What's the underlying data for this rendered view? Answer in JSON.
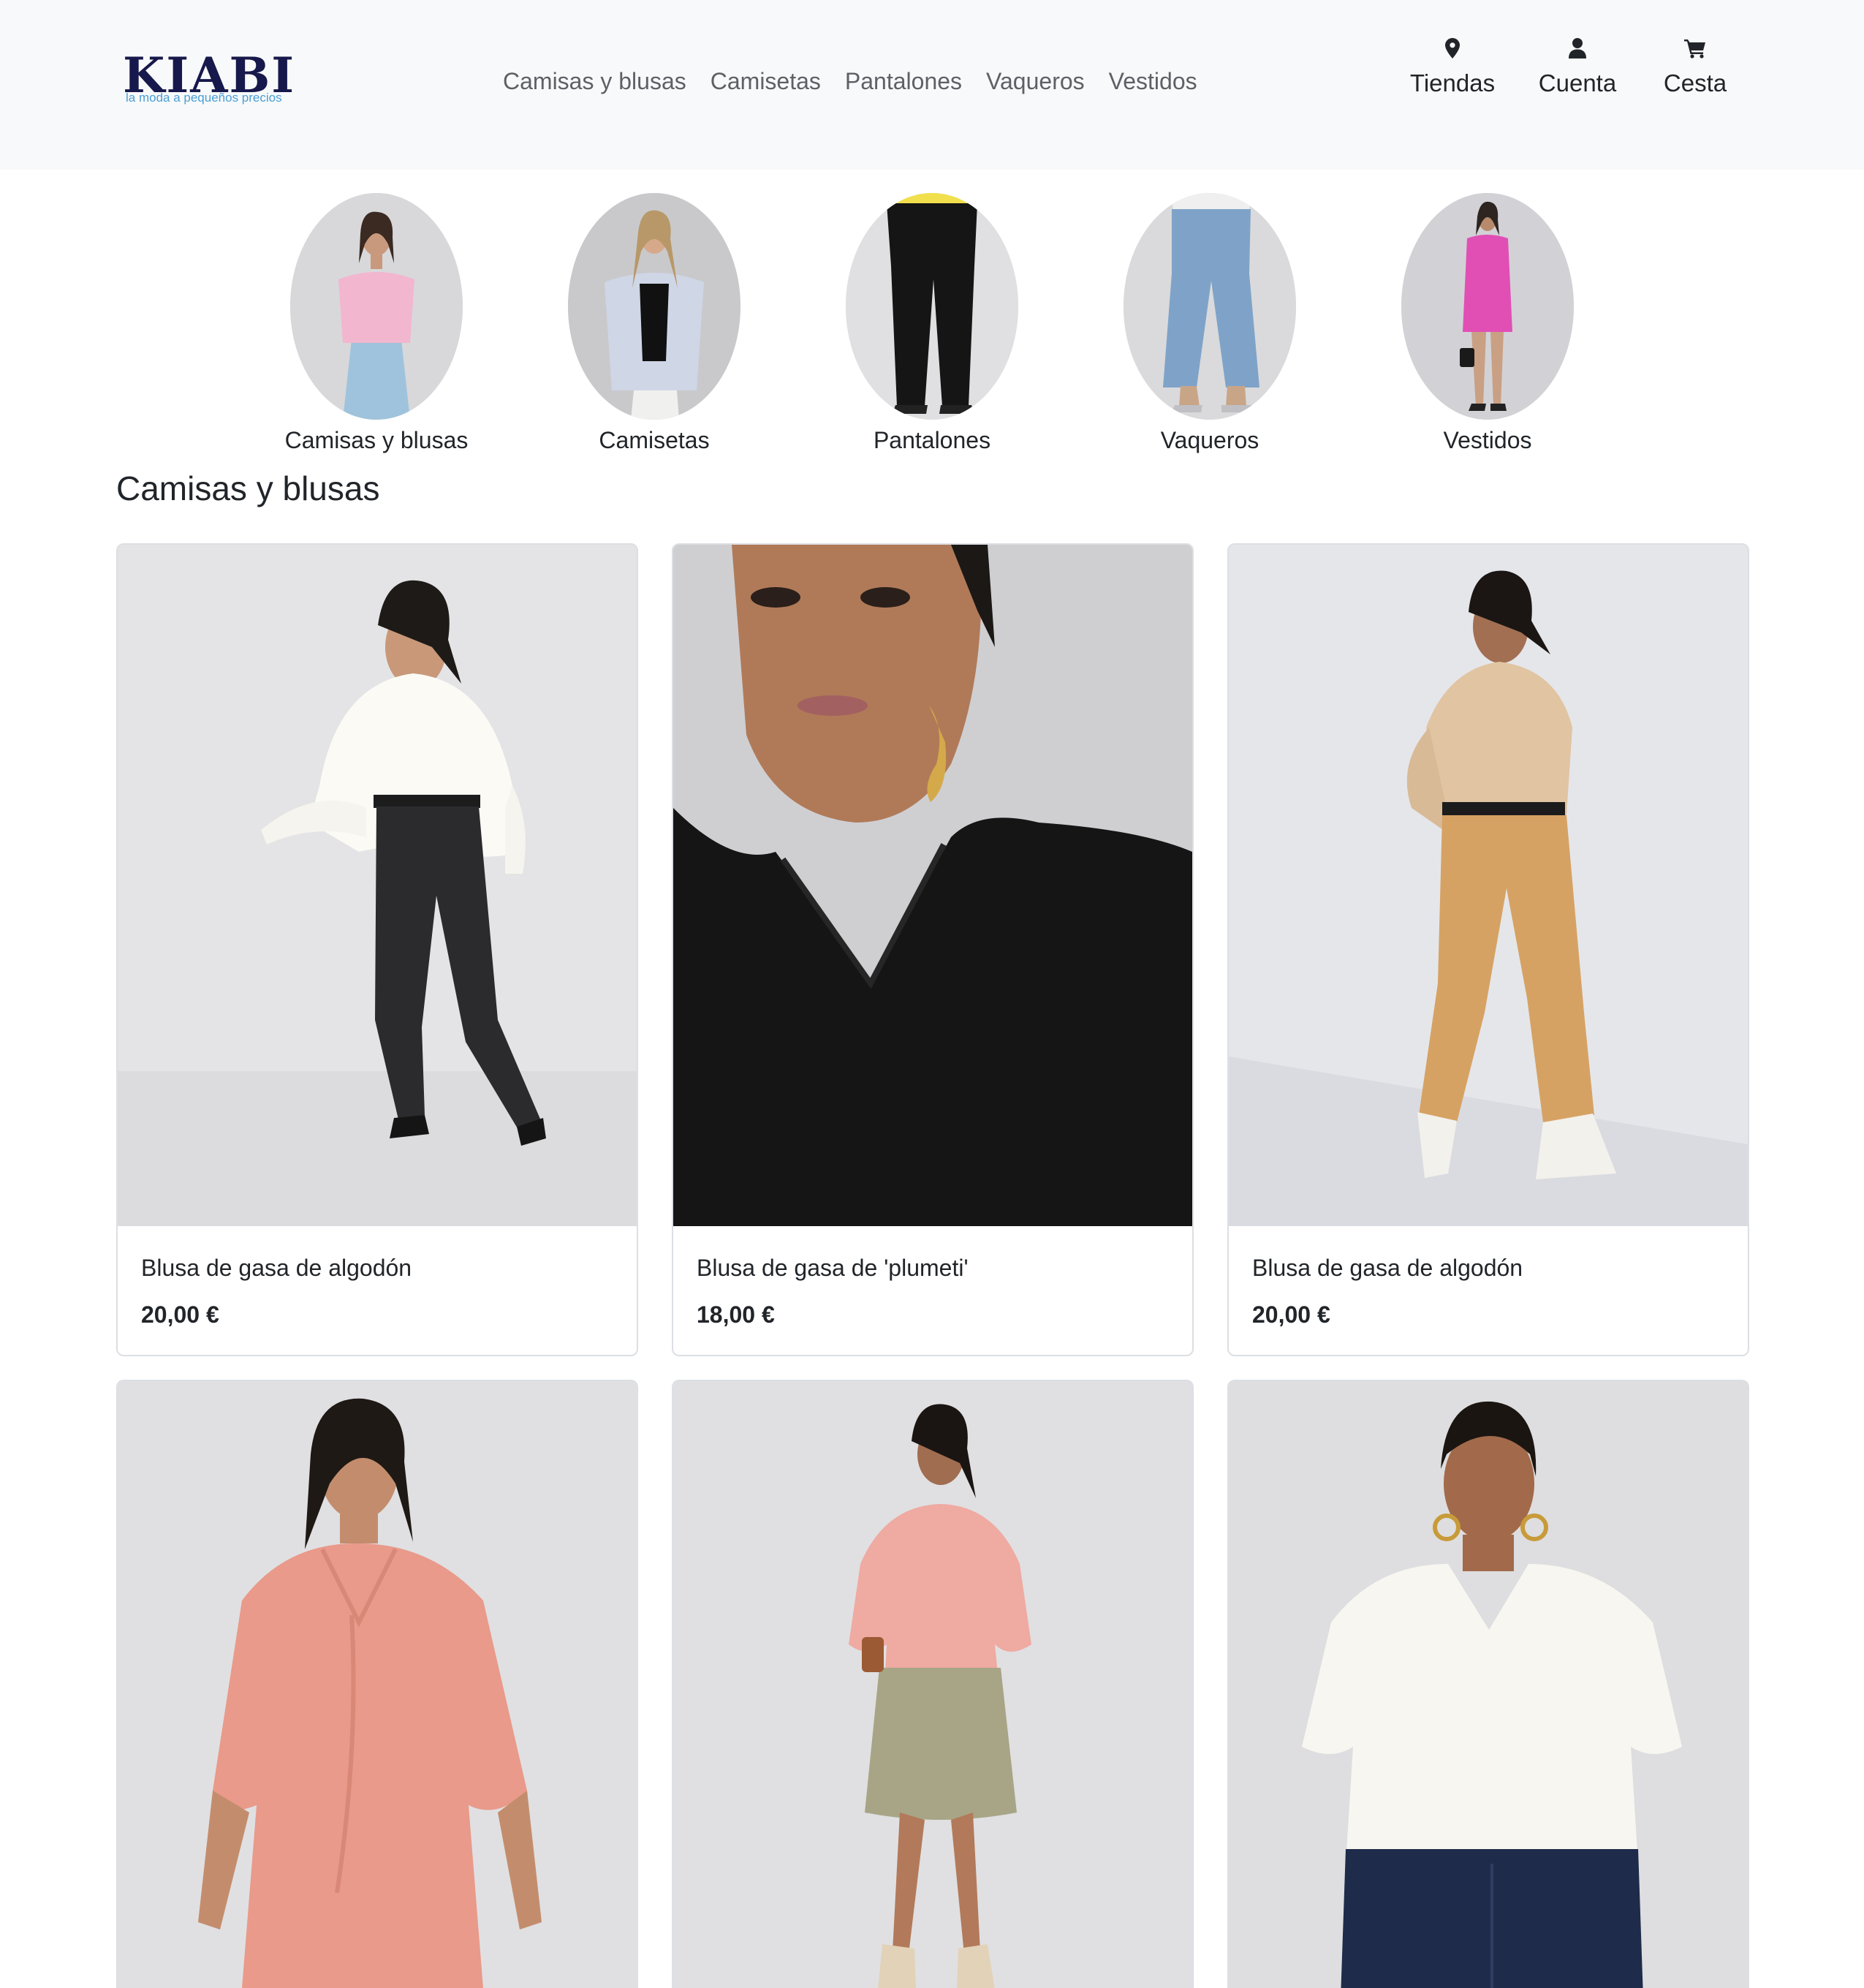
{
  "brand": {
    "name": "KIABI",
    "tagline": "la moda a pequeños precios",
    "color": "#17184b",
    "tagline_color": "#4a9fd4"
  },
  "nav": {
    "items": [
      {
        "label": "Camisas y blusas"
      },
      {
        "label": "Camisetas"
      },
      {
        "label": "Pantalones"
      },
      {
        "label": "Vaqueros"
      },
      {
        "label": "Vestidos"
      }
    ]
  },
  "header_actions": {
    "stores": {
      "label": "Tiendas",
      "icon": "map-marker-icon"
    },
    "account": {
      "label": "Cuenta",
      "icon": "user-icon"
    },
    "cart": {
      "label": "Cesta",
      "icon": "shopping-cart-icon"
    }
  },
  "categories": [
    {
      "label": "Camisas y blusas",
      "image": "woman in pink t-shirt and light jeans"
    },
    {
      "label": "Camisetas",
      "image": "woman in striped open shirt over black top"
    },
    {
      "label": "Pantalones",
      "image": "black wide-leg trousers"
    },
    {
      "label": "Vaqueros",
      "image": "light blue wide-leg jeans"
    },
    {
      "label": "Vestidos",
      "image": "woman in pink dress with black bag"
    }
  ],
  "section": {
    "title": "Camisas y blusas"
  },
  "products": [
    {
      "name": "Blusa de gasa de algodón",
      "price": "20,00 €",
      "image": "woman in white cotton gauze blouse and black jeans"
    },
    {
      "name": "Blusa de gasa de 'plumeti'",
      "price": "18,00 €",
      "image": "close-up of woman in black plumeti blouse"
    },
    {
      "name": "Blusa de gasa de algodón",
      "price": "20,00 €",
      "image": "woman in beige blouse and camel trousers"
    },
    {
      "name": "",
      "price": "",
      "image": "woman in pink draped tunic"
    },
    {
      "name": "",
      "price": "",
      "image": "woman in pink blouse and khaki skirt"
    },
    {
      "name": "",
      "price": "",
      "image": "woman in white blouse and dark jeans"
    }
  ]
}
